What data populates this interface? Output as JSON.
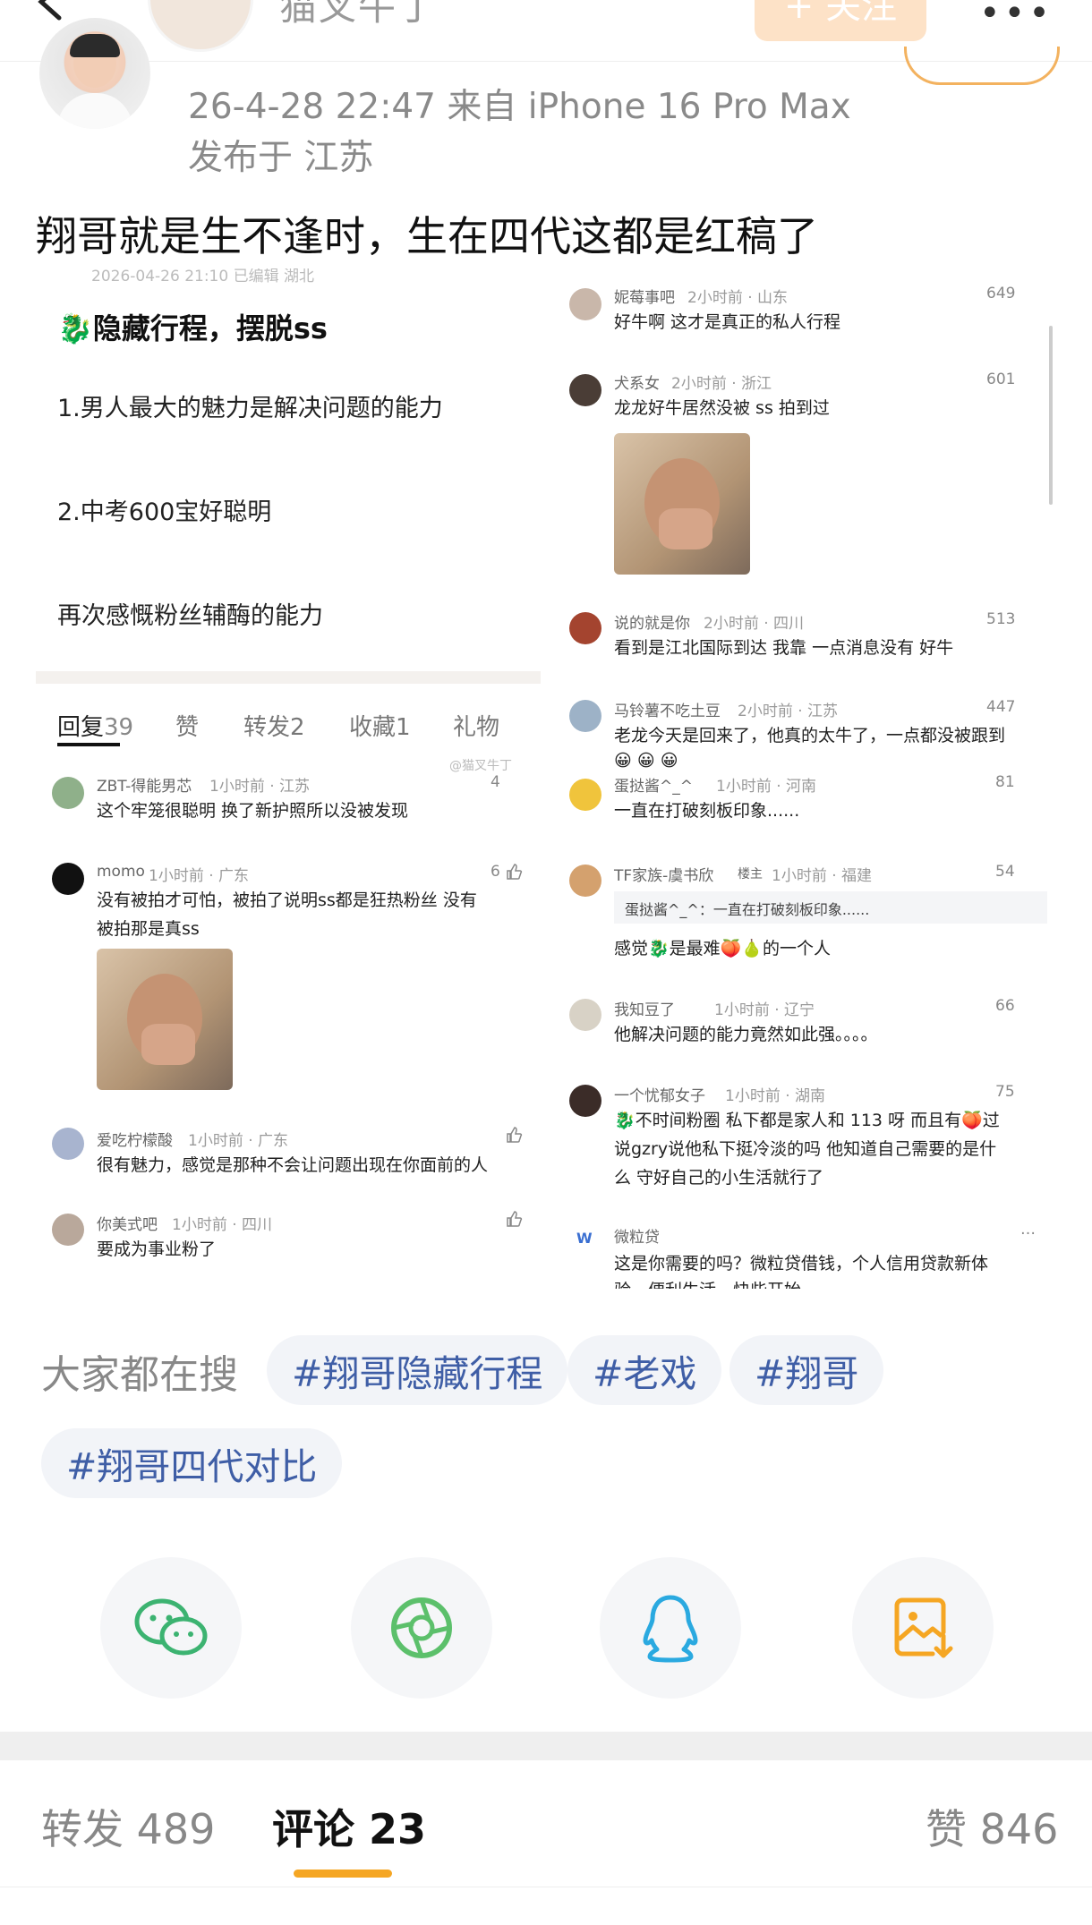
{
  "header": {
    "author_name": "猫叉牛丁",
    "follow_label": "+ 关注",
    "more_label": "•••"
  },
  "post": {
    "time_device": "26-4-28 22:47  来自 iPhone 16 Pro Max",
    "location": "发布于 江苏",
    "text": "翔哥就是生不逢时，生在四代这都是红稿了"
  },
  "embedded": {
    "top_meta": "2026-04-26 21:10 已编辑 湖北",
    "title": "🐉隐藏行程，摆脱ss",
    "line1": "1.男人最大的魅力是解决问题的能力",
    "line2": "2.中考600宝好聪明",
    "line3": "再次感慨粉丝辅酶的能力",
    "tabs": [
      "回复",
      "39",
      "赞",
      "转发2",
      "收藏1",
      "礼物"
    ],
    "watermark": "@猫叉牛丁",
    "left_comments": [
      {
        "name": "ZBT-得能男芯",
        "meta": "1小时前 · 江苏",
        "likes": "4",
        "text": "这个牢笼很聪明 换了新护照所以没被发现"
      },
      {
        "name": "momo",
        "meta": "1小时前 · 广东",
        "likes": "6",
        "text": "没有被拍才可怕，被拍了说明ss都是狂热粉丝 没有",
        "text2": "被拍那是真ss"
      },
      {
        "name": "爱吃柠檬酸",
        "meta": "1小时前 · 广东",
        "likes": "",
        "text": "很有魅力，感觉是那种不会让问题出现在你面前的人"
      },
      {
        "name": "你美式吧",
        "meta": "1小时前 · 四川",
        "likes": "",
        "text": "要成为事业粉了"
      }
    ],
    "right_comments": [
      {
        "name": "妮莓事吧",
        "meta": "2小时前 · 山东",
        "likes": "649",
        "text": "好牛啊 这才是真正的私人行程"
      },
      {
        "name": "犬系女",
        "meta": "2小时前 · 浙江",
        "likes": "601",
        "text": "龙龙好牛居然没被 ss 拍到过"
      },
      {
        "name": "说的就是你",
        "meta": "2小时前 · 四川",
        "likes": "513",
        "text": "看到是江北国际到达 我靠 一点消息没有 好牛"
      },
      {
        "name": "马铃薯不吃土豆",
        "meta": "2小时前 · 江苏",
        "likes": "447",
        "text": "老龙今天是回来了，他真的太牛了，一点都没被跟到",
        "text2": "😀 😀 😀"
      },
      {
        "name": "蛋挞酱^_^",
        "meta": "1小时前 · 河南",
        "likes": "81",
        "text": "一直在打破刻板印象......"
      },
      {
        "name": "TF家族-虞书欣",
        "badge": "楼主",
        "meta": "1小时前 · 福建",
        "likes": "54",
        "quote": "蛋挞酱^_^：一直在打破刻板印象......",
        "text": "感觉🐉是最难🍑🍐的一个人"
      },
      {
        "name": "我知豆了",
        "meta": "1小时前 · 辽宁",
        "likes": "66",
        "text": "他解决问题的能力竟然如此强。。。。"
      },
      {
        "name": "一个忧郁女子",
        "meta": "1小时前 · 湖南",
        "likes": "75",
        "text": "🐉不时间粉圈 私下都是家人和 113 呀 而且有🍑过",
        "text2": "说gzry说他私下挺冷淡的吗 他知道自己需要的是什",
        "text3": "么 守好自己的小生活就行了"
      },
      {
        "name": "微粒贷",
        "meta": "",
        "likes": "…",
        "text": "这是你需要的吗？微粒贷借钱，个人信用贷款新体",
        "text2": "验，便利生活，快些开始"
      }
    ]
  },
  "hot_search": {
    "label": "大家都在搜",
    "tags": [
      "#翔哥隐藏行程",
      "#老戏",
      "#翔哥",
      "#翔哥四代对比"
    ]
  },
  "share": {
    "icons": [
      "wechat-icon",
      "moments-icon",
      "qq-icon",
      "save-image-icon"
    ]
  },
  "bottom": {
    "repost": "转发 489",
    "comment": "评论 23",
    "like": "赞 846"
  },
  "colors": {
    "accent": "#f5a623",
    "tag_text": "#3f5ea6",
    "tag_bg": "#f2f4f8"
  }
}
